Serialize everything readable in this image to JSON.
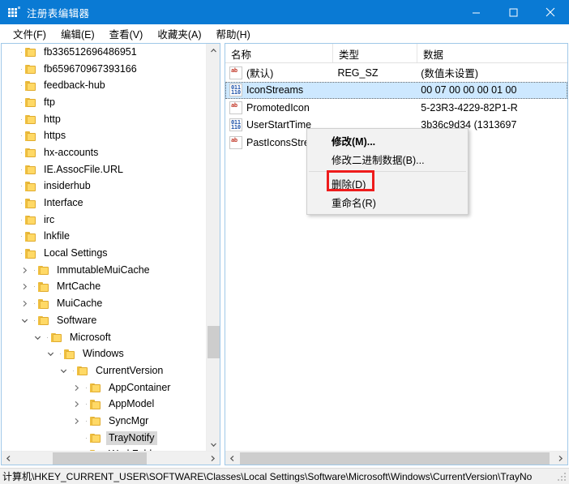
{
  "window": {
    "title": "注册表编辑器",
    "icon": "registry-app-icon",
    "accent_color": "#0a7ad4",
    "controls": {
      "minimize": "minimize-icon",
      "maximize": "maximize-icon",
      "close": "close-icon"
    }
  },
  "menubar": {
    "items": [
      {
        "label": "文件(F)"
      },
      {
        "label": "编辑(E)"
      },
      {
        "label": "查看(V)"
      },
      {
        "label": "收藏夹(A)"
      },
      {
        "label": "帮助(H)"
      }
    ]
  },
  "tree": {
    "nodes": [
      {
        "label": "fb336512696486951",
        "depth": 0,
        "twisty": "none",
        "selected": false
      },
      {
        "label": "fb659670967393166",
        "depth": 0,
        "twisty": "none",
        "selected": false
      },
      {
        "label": "feedback-hub",
        "depth": 0,
        "twisty": "none",
        "selected": false
      },
      {
        "label": "ftp",
        "depth": 0,
        "twisty": "none",
        "selected": false
      },
      {
        "label": "http",
        "depth": 0,
        "twisty": "none",
        "selected": false
      },
      {
        "label": "https",
        "depth": 0,
        "twisty": "none",
        "selected": false
      },
      {
        "label": "hx-accounts",
        "depth": 0,
        "twisty": "none",
        "selected": false
      },
      {
        "label": "IE.AssocFile.URL",
        "depth": 0,
        "twisty": "none",
        "selected": false
      },
      {
        "label": "insiderhub",
        "depth": 0,
        "twisty": "none",
        "selected": false
      },
      {
        "label": "Interface",
        "depth": 0,
        "twisty": "none",
        "selected": false
      },
      {
        "label": "irc",
        "depth": 0,
        "twisty": "none",
        "selected": false
      },
      {
        "label": "lnkfile",
        "depth": 0,
        "twisty": "none",
        "selected": false
      },
      {
        "label": "Local Settings",
        "depth": 0,
        "twisty": "none",
        "selected": false
      },
      {
        "label": "ImmutableMuiCache",
        "depth": 1,
        "twisty": "collapsed",
        "selected": false
      },
      {
        "label": "MrtCache",
        "depth": 1,
        "twisty": "collapsed",
        "selected": false
      },
      {
        "label": "MuiCache",
        "depth": 1,
        "twisty": "collapsed",
        "selected": false
      },
      {
        "label": "Software",
        "depth": 1,
        "twisty": "expanded",
        "selected": false
      },
      {
        "label": "Microsoft",
        "depth": 2,
        "twisty": "expanded",
        "selected": false
      },
      {
        "label": "Windows",
        "depth": 3,
        "twisty": "expanded",
        "selected": false
      },
      {
        "label": "CurrentVersion",
        "depth": 4,
        "twisty": "expanded",
        "selected": false
      },
      {
        "label": "AppContainer",
        "depth": 5,
        "twisty": "collapsed",
        "selected": false
      },
      {
        "label": "AppModel",
        "depth": 5,
        "twisty": "collapsed",
        "selected": false
      },
      {
        "label": "SyncMgr",
        "depth": 5,
        "twisty": "collapsed",
        "selected": false
      },
      {
        "label": "TrayNotify",
        "depth": 5,
        "twisty": "none",
        "selected": true
      },
      {
        "label": "WorkFolders",
        "depth": 5,
        "twisty": "none",
        "selected": false
      }
    ]
  },
  "list": {
    "columns": [
      {
        "key": "name",
        "label": "名称"
      },
      {
        "key": "type",
        "label": "类型"
      },
      {
        "key": "data",
        "label": "数据"
      }
    ],
    "rows": [
      {
        "name": "(默认)",
        "type": "REG_SZ",
        "data": "(数值未设置)",
        "icon": "string-value-icon",
        "selected": false
      },
      {
        "name": "IconStreams",
        "type": "",
        "data": "00 07 00 00 00 01 00",
        "icon": "binary-value-icon",
        "selected": true
      },
      {
        "name": "PromotedIcon",
        "type": "",
        "data": "5-23R3-4229-82P1-R",
        "icon": "string-value-icon",
        "selected": false
      },
      {
        "name": "UserStartTime",
        "type": "",
        "data": "3b36c9d34 (1313697",
        "icon": "binary-value-icon",
        "selected": false
      },
      {
        "name": "PastIconsStre",
        "type": "",
        "data": "",
        "icon": "string-value-icon",
        "selected": false
      }
    ]
  },
  "context_menu": {
    "items": [
      {
        "label": "修改(M)...",
        "bold": true,
        "separator_after": false,
        "highlighted": false
      },
      {
        "label": "修改二进制数据(B)...",
        "bold": false,
        "separator_after": true,
        "highlighted": false
      },
      {
        "label": "删除(D)",
        "bold": false,
        "separator_after": false,
        "highlighted": true
      },
      {
        "label": "重命名(R)",
        "bold": false,
        "separator_after": false,
        "highlighted": false
      }
    ],
    "highlight_color": "#ee1c1c"
  },
  "statusbar": {
    "path": "计算机\\HKEY_CURRENT_USER\\SOFTWARE\\Classes\\Local Settings\\Software\\Microsoft\\Windows\\CurrentVersion\\TrayNo"
  },
  "scrollbars": {
    "tree_vertical": {
      "up": "chevron-up-icon",
      "down": "chevron-down-icon"
    },
    "tree_horizontal": {
      "left": "chevron-left-icon",
      "right": "chevron-right-icon"
    },
    "list_horizontal": {
      "left": "chevron-left-icon",
      "right": "chevron-right-icon"
    }
  }
}
